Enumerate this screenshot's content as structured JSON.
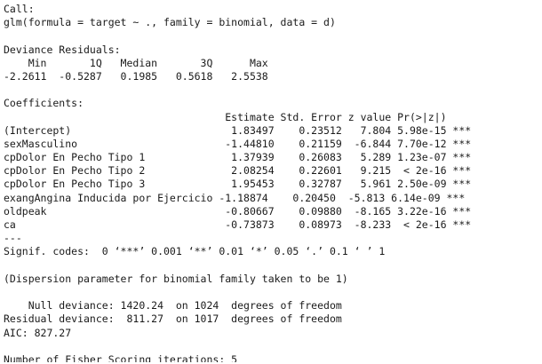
{
  "console": {
    "lines": [
      "Call:",
      "glm(formula = target ~ ., family = binomial, data = d)",
      "",
      "Deviance Residuals:",
      "    Min       1Q   Median       3Q      Max",
      "-2.2611  -0.5287   0.1985   0.5618   2.5538",
      "",
      "Coefficients:",
      "                                    Estimate Std. Error z value Pr(>|z|)",
      "(Intercept)                          1.83497    0.23512   7.804 5.98e-15 ***",
      "sexMasculino                        -1.44810    0.21159  -6.844 7.70e-12 ***",
      "cpDolor En Pecho Tipo 1              1.37939    0.26083   5.289 1.23e-07 ***",
      "cpDolor En Pecho Tipo 2              2.08254    0.22601   9.215  < 2e-16 ***",
      "cpDolor En Pecho Tipo 3              1.95453    0.32787   5.961 2.50e-09 ***",
      "exangAngina Inducida por Ejercicio -1.18874    0.20450  -5.813 6.14e-09 ***",
      "oldpeak                             -0.80667    0.09880  -8.165 3.22e-16 ***",
      "ca                                  -0.73873    0.08973  -8.233  < 2e-16 ***",
      "---",
      "Signif. codes:  0 ‘***’ 0.001 ‘**’ 0.01 ‘*’ 0.05 ‘.’ 0.1 ‘ ’ 1",
      "",
      "(Dispersion parameter for binomial family taken to be 1)",
      "",
      "    Null deviance: 1420.24  on 1024  degrees of freedom",
      "Residual deviance:  811.27  on 1017  degrees of freedom",
      "AIC: 827.27",
      "",
      "Number of Fisher Scoring iterations: 5"
    ]
  }
}
